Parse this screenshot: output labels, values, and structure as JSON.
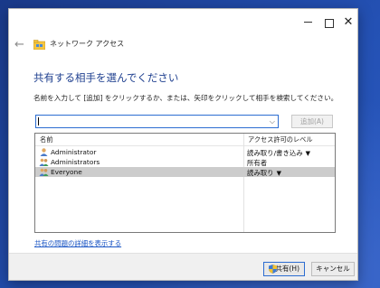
{
  "nav": {
    "title": "ネットワーク アクセス"
  },
  "heading": "共有する相手を選んでください",
  "instruction": "名前を入力して [追加] をクリックするか、または、矢印をクリックして相手を検索してください。",
  "combo": {
    "value": ""
  },
  "add_button": "追加(A)",
  "list": {
    "columns": {
      "name": "名前",
      "permission": "アクセス許可のレベル"
    },
    "rows": [
      {
        "name": "Administrator",
        "permission": "読み取り/書き込み",
        "has_menu": true,
        "icon": "user-icon"
      },
      {
        "name": "Administrators",
        "permission": "所有者",
        "has_menu": false,
        "icon": "group-icon"
      },
      {
        "name": "Everyone",
        "permission": "読み取り",
        "has_menu": true,
        "icon": "group-icon",
        "selected": true
      }
    ]
  },
  "link": "共有の問題の詳細を表示する",
  "buttons": {
    "share": "共有(H)",
    "cancel": "キャンセル"
  },
  "colors": {
    "accent": "#2c6dd1",
    "heading": "#1e3f8f",
    "link": "#1a55c4",
    "selected_row": "#cccccc"
  }
}
